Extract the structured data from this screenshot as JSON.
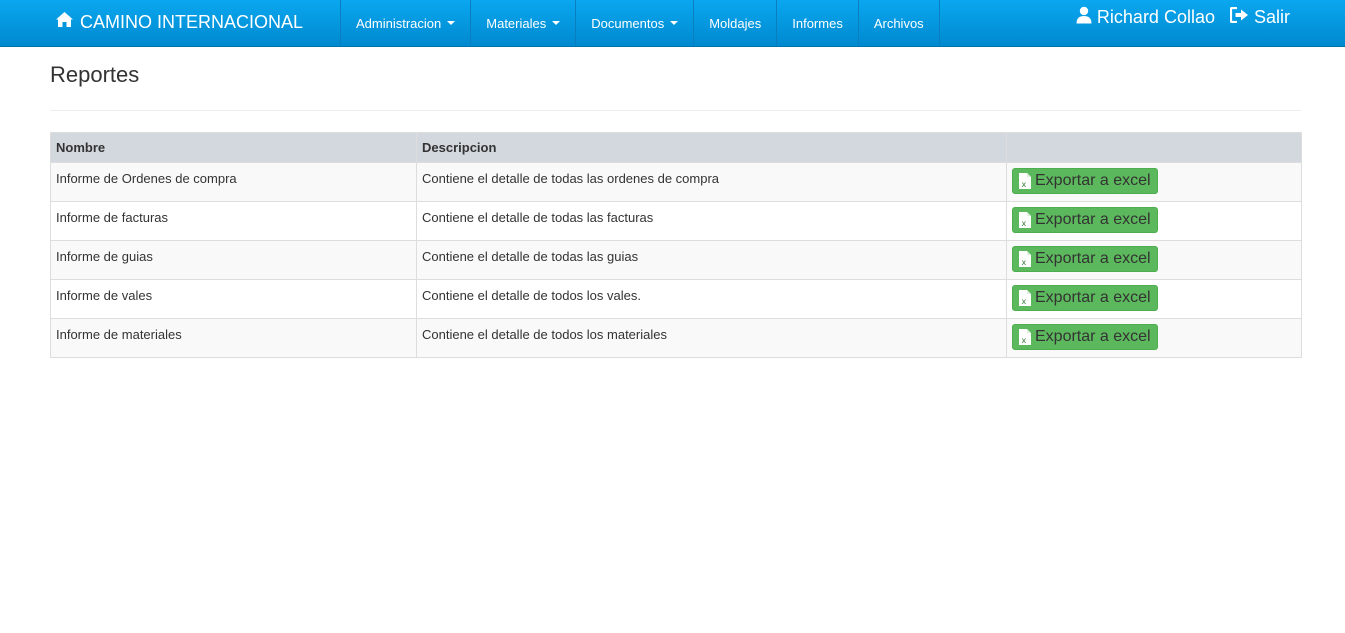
{
  "navbar": {
    "brand": "CAMINO INTERNACIONAL",
    "items": [
      {
        "label": "Administracion",
        "dropdown": true
      },
      {
        "label": "Materiales",
        "dropdown": true
      },
      {
        "label": "Documentos",
        "dropdown": true
      },
      {
        "label": "Moldajes",
        "dropdown": false
      },
      {
        "label": "Informes",
        "dropdown": false
      },
      {
        "label": "Archivos",
        "dropdown": false
      }
    ],
    "user": "Richard Collao",
    "logout": "Salir"
  },
  "page": {
    "title": "Reportes"
  },
  "table": {
    "headers": [
      "Nombre",
      "Descripcion",
      ""
    ],
    "rows": [
      {
        "name": "Informe de Ordenes de compra",
        "description": "Contiene el detalle de todas las ordenes de compra",
        "action": "Exportar a excel"
      },
      {
        "name": "Informe de facturas",
        "description": "Contiene el detalle de todas las facturas",
        "action": "Exportar a excel"
      },
      {
        "name": "Informe de guias",
        "description": "Contiene el detalle de todas las guias",
        "action": "Exportar a excel"
      },
      {
        "name": "Informe de vales",
        "description": "Contiene el detalle de todos los vales.",
        "action": "Exportar a excel"
      },
      {
        "name": "Informe de materiales",
        "description": "Contiene el detalle de todos los materiales",
        "action": "Exportar a excel"
      }
    ]
  },
  "colors": {
    "navbar": "#0096dc",
    "button": "#5cb85c",
    "header_row": "#d2d8de"
  },
  "icons": {
    "brand": "home-icon",
    "user": "user-icon",
    "logout": "sign-out-icon",
    "export": "file-excel-icon"
  }
}
